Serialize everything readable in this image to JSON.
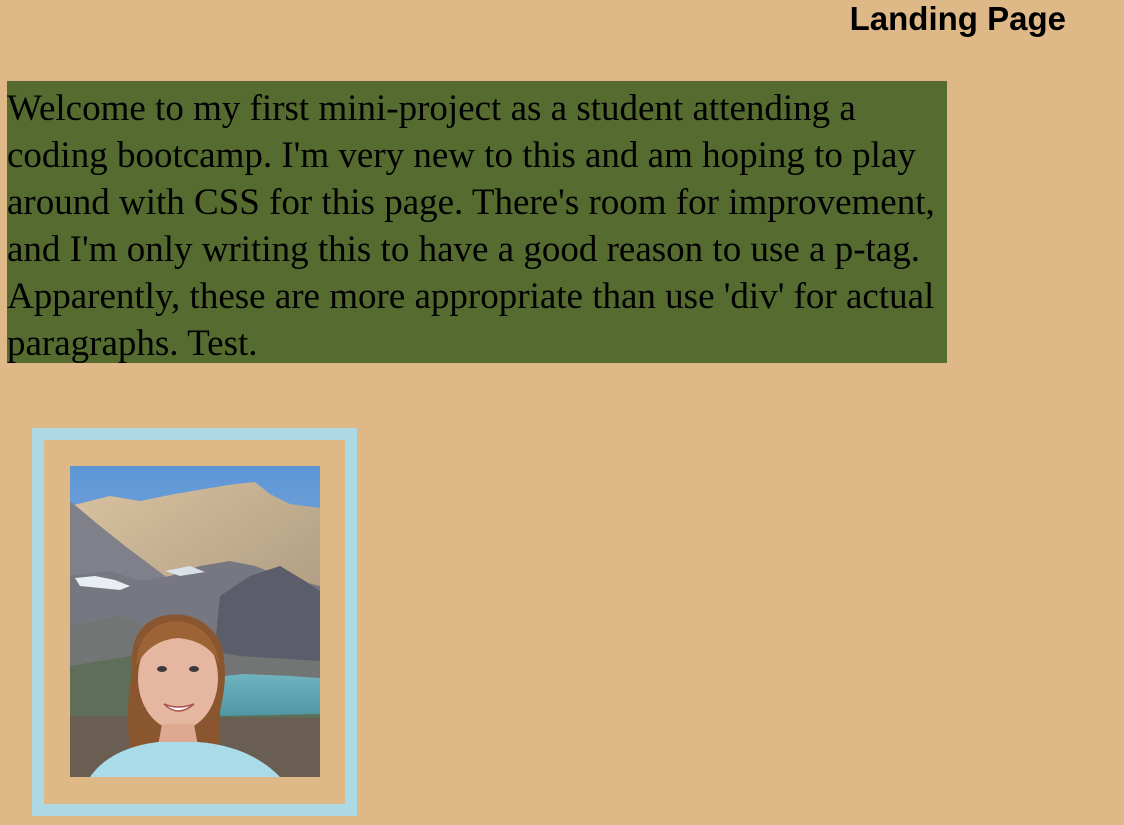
{
  "header": {
    "title": "Landing Page"
  },
  "intro": {
    "text": "Welcome to my first mini-project as a student attending a coding bootcamp. I'm very new to this and am hoping to play around with CSS for this page. There's room for improvement, and I'm only writing this to have a good reason to use a p-tag. Apparently, these are more appropriate than use 'div' for actual paragraphs. Test."
  },
  "colors": {
    "page_background": "#DEB887",
    "paragraph_background": "#556B2F",
    "frame_border": "#ADD8E6",
    "text": "#000000"
  }
}
